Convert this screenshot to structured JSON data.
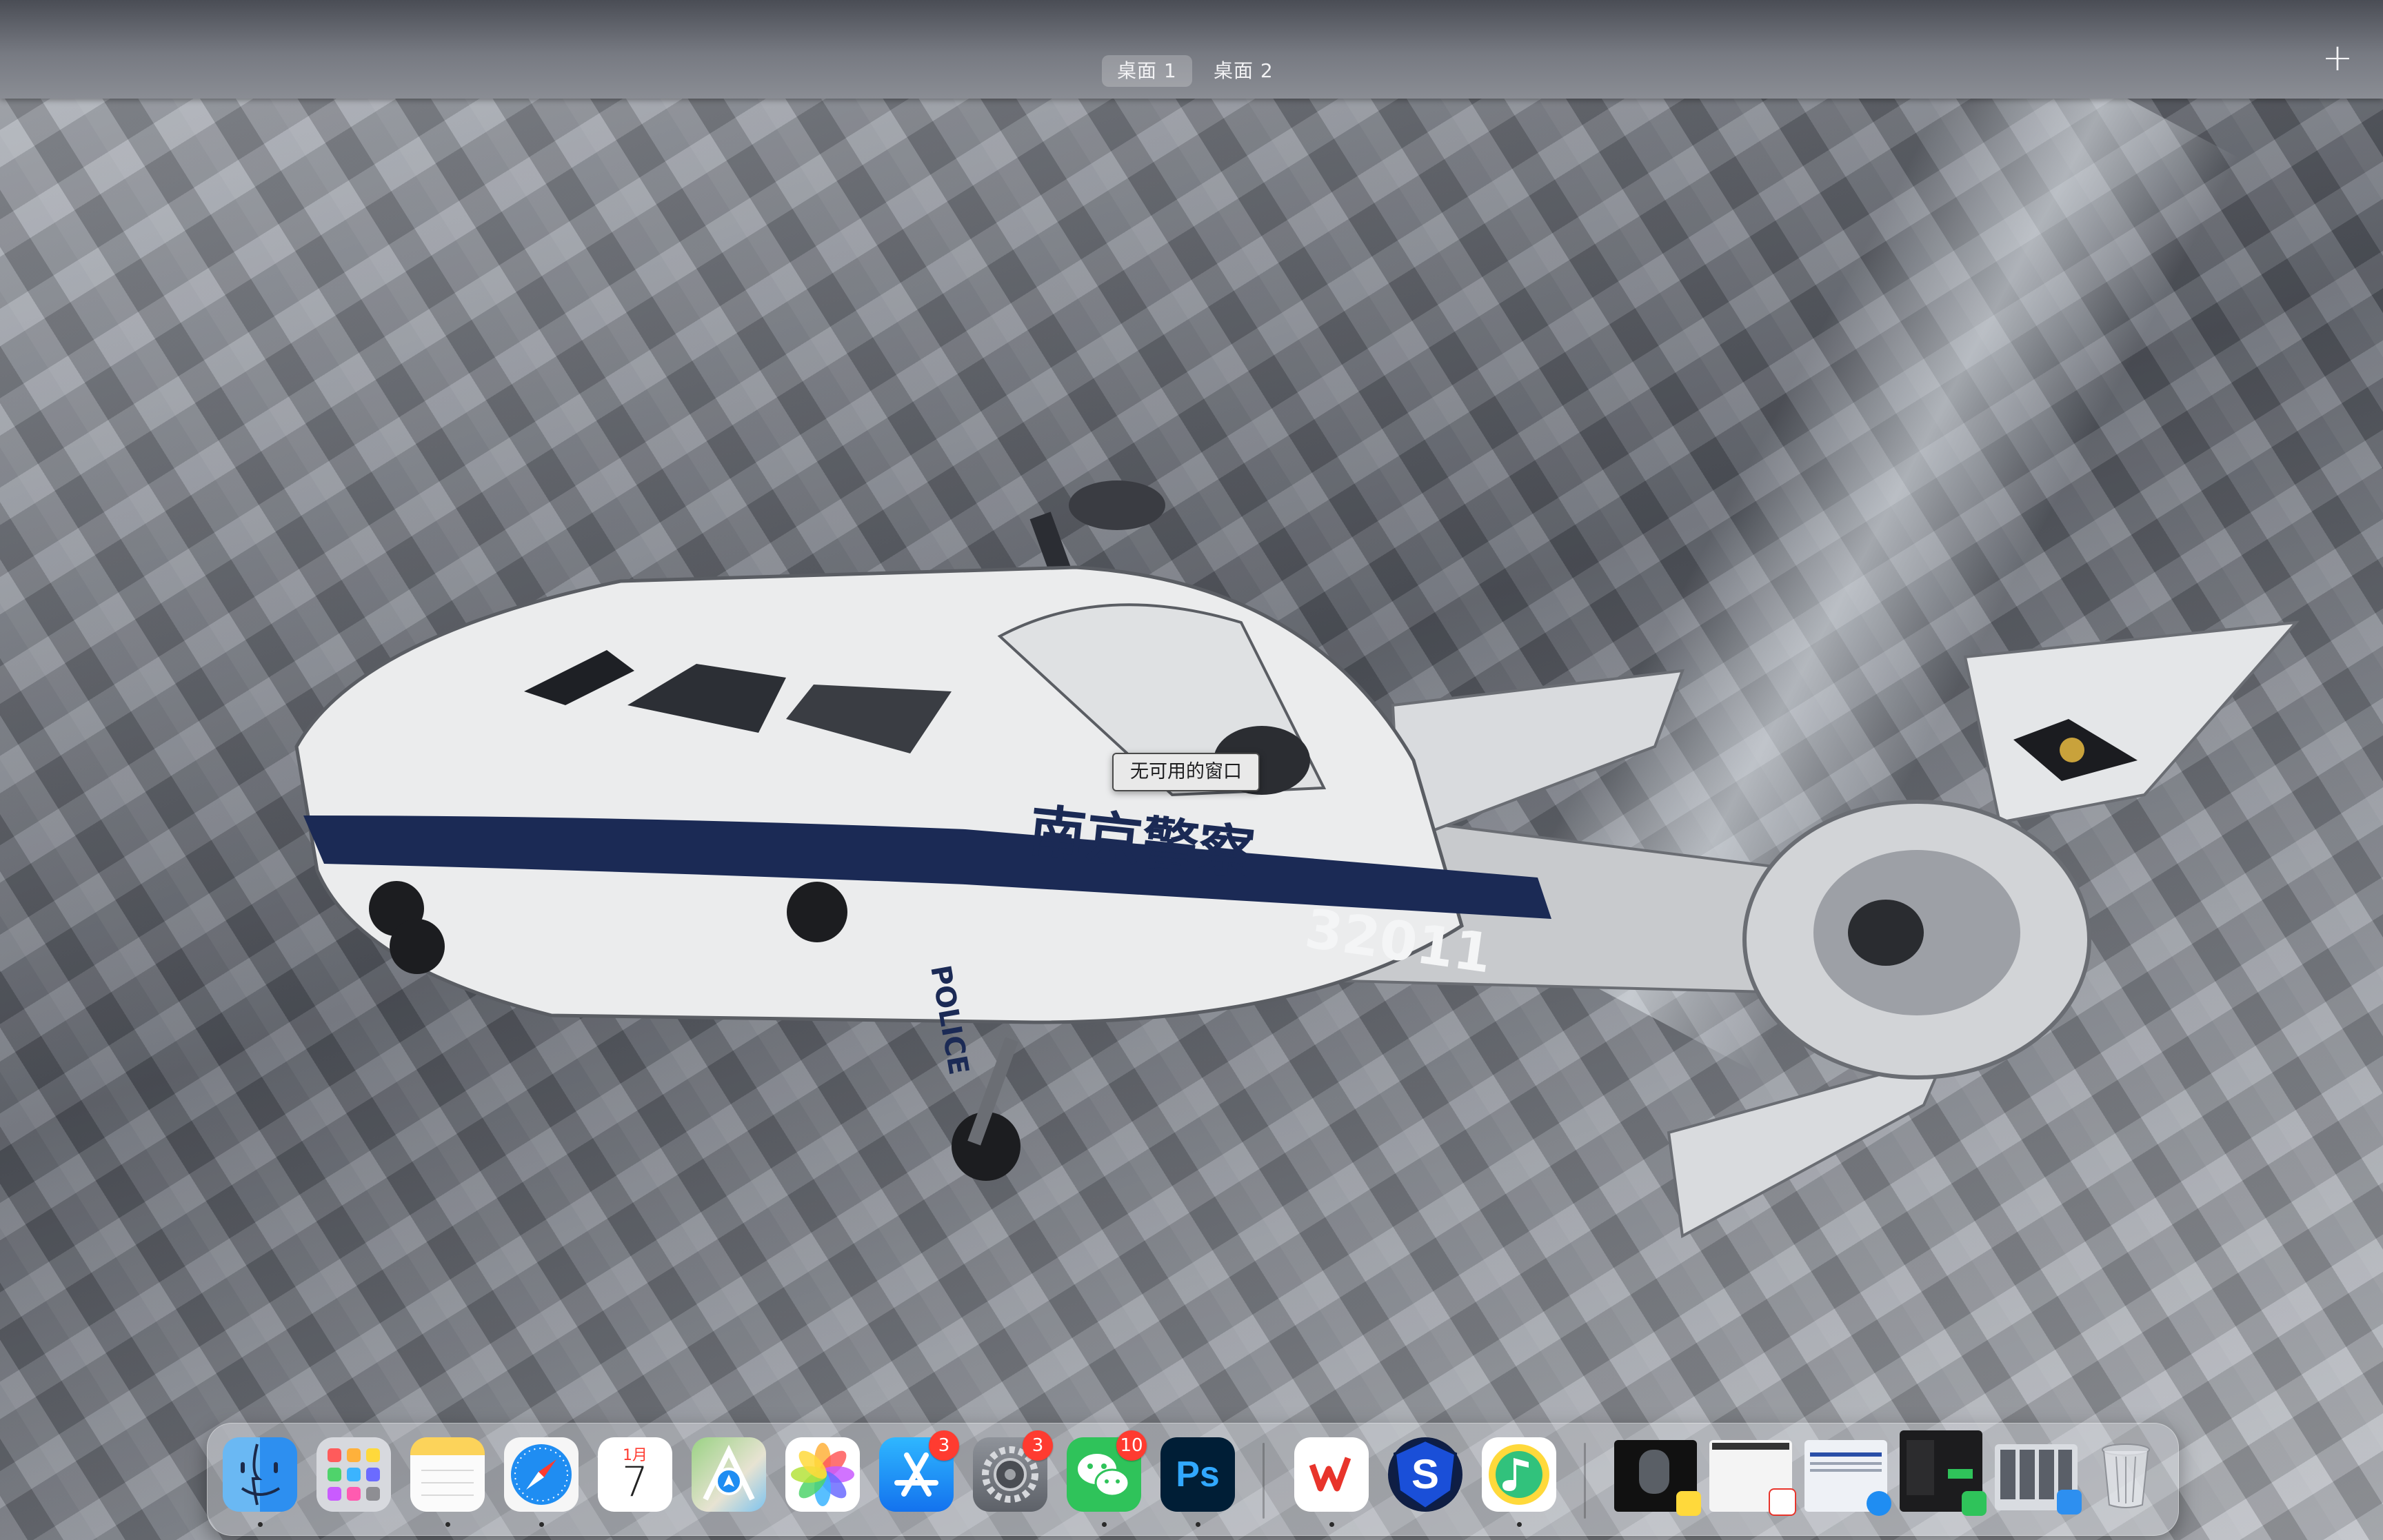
{
  "spaces": {
    "tabs": [
      {
        "label": "桌面 1",
        "active": true
      },
      {
        "label": "桌面 2",
        "active": false
      }
    ],
    "add_icon": "plus-icon"
  },
  "tooltip": {
    "text": "无可用的窗口"
  },
  "wallpaper": {
    "subject": "police-helicopter",
    "hull_text": "南京警察",
    "tail_number": "32011",
    "side_text": "POLICE"
  },
  "dock": {
    "apps": [
      {
        "name": "Finder",
        "icon": "finder-icon",
        "running": true
      },
      {
        "name": "Launchpad",
        "icon": "launchpad-icon",
        "running": false
      },
      {
        "name": "Notes",
        "icon": "notes-icon",
        "running": true
      },
      {
        "name": "Safari",
        "icon": "safari-icon",
        "running": true
      },
      {
        "name": "Calendar",
        "icon": "calendar-icon",
        "month": "1月",
        "day": "7",
        "running": false
      },
      {
        "name": "Maps",
        "icon": "maps-icon",
        "running": false
      },
      {
        "name": "Photos",
        "icon": "photos-icon",
        "running": false
      },
      {
        "name": "App Store",
        "icon": "app-store-icon",
        "badge": "3",
        "running": false
      },
      {
        "name": "System Settings",
        "icon": "settings-icon",
        "badge": "3",
        "running": false
      },
      {
        "name": "WeChat",
        "icon": "wechat-icon",
        "badge": "10",
        "running": true
      },
      {
        "name": "Photoshop",
        "icon": "photoshop-icon",
        "label": "Ps",
        "running": true
      },
      {
        "name": "WPS Office",
        "icon": "wps-icon",
        "running": true
      },
      {
        "name": "S App",
        "icon": "s-app-icon",
        "label": "S",
        "running": false
      },
      {
        "name": "QQ Music",
        "icon": "qq-music-icon",
        "running": true
      }
    ],
    "minimized": [
      "window-thumbnail-video",
      "window-thumbnail-wps",
      "window-thumbnail-safari",
      "window-thumbnail-wechat",
      "window-thumbnail-finder"
    ],
    "trash": "trash-icon"
  },
  "colors": {
    "badge": "#ff3b30",
    "hull_blue": "#1b2a55",
    "ps_blue": "#31a8ff"
  }
}
